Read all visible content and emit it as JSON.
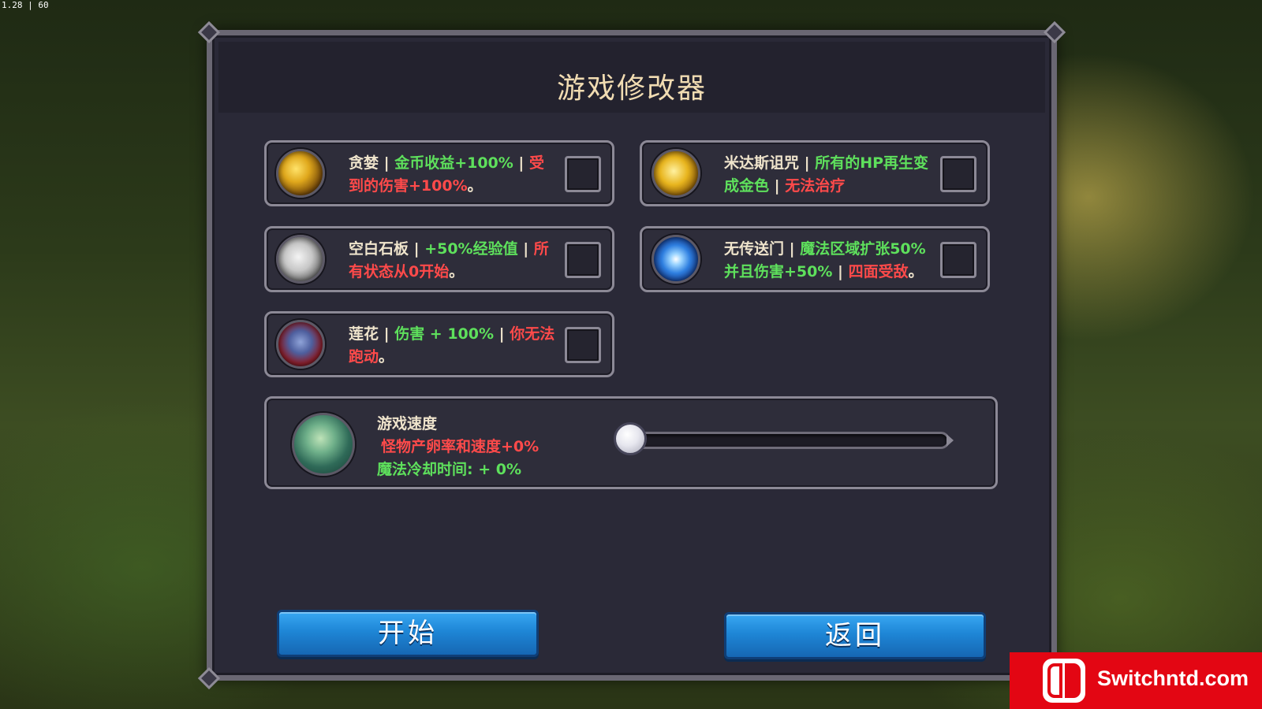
{
  "fps_counter": "1.28 | 60",
  "dialog": {
    "title": "游戏修改器"
  },
  "mods": [
    {
      "name": "贪婪",
      "sep1": " | ",
      "bonus": "金币收益+100%",
      "sep2": " | ",
      "penalty": "受到的伤害+100%",
      "end": "。",
      "icon": "gold-coins-icon",
      "checked": false
    },
    {
      "name": "米达斯诅咒",
      "sep1": " | ",
      "bonus": "所有的HP再生变成金色",
      "sep2": " | ",
      "penalty": "无法治疗",
      "end": "",
      "icon": "golden-scarab-coin-icon",
      "checked": false
    },
    {
      "name": "空白石板",
      "sep1": " | ",
      "bonus": "+50%经验值",
      "sep2": " | ",
      "penalty": "所有状态从0开始",
      "end": "。",
      "icon": "blank-slate-moon-icon",
      "checked": false
    },
    {
      "name": "无传送门",
      "sep1": " | ",
      "bonus": "魔法区域扩张50%并且伤害+50%",
      "sep2": " | ",
      "penalty": "四面受敌",
      "end": "。",
      "icon": "blue-portal-icon",
      "checked": false
    },
    {
      "name": "莲花",
      "sep1": " | ",
      "bonus": "伤害 + 100%",
      "sep2": " | ",
      "penalty": "你无法跑动",
      "end": "。",
      "icon": "lotus-face-icon",
      "checked": false
    }
  ],
  "speed": {
    "label": "游戏速度",
    "spawn_text": "怪物产卵率和速度+0%",
    "cooldown_text": "魔法冷却时间: + 0%",
    "slider_value": 0,
    "icon": "hourglass-swirl-icon"
  },
  "buttons": {
    "start": "开始",
    "back": "返回"
  },
  "watermark": {
    "text": "Switchntd.com",
    "icon": "nintendo-switch-logo-icon"
  },
  "colors": {
    "bonus": "#5ee05c",
    "penalty": "#ff4a4a",
    "button": "#1e86d6",
    "watermark": "#e30613"
  }
}
